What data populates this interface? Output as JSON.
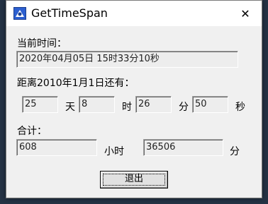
{
  "window": {
    "title": "GetTimeSpan",
    "close_glyph": "✕"
  },
  "current_time": {
    "label": "当前时间：",
    "value": "2020年04月05日 15时33分10秒"
  },
  "since": {
    "label": "距离2010年1月1日还有：",
    "days_value": "25",
    "days_unit": "天",
    "hours_value": "8",
    "hours_unit": "时",
    "minutes_value": "26",
    "minutes_unit": "分",
    "seconds_value": "50",
    "seconds_unit": "秒"
  },
  "total": {
    "label": "合计：",
    "hours_value": "608",
    "hours_unit": "小时",
    "minutes_value": "36506",
    "minutes_unit": "分"
  },
  "exit_button": {
    "label": "退出"
  },
  "icons": {
    "app": "app-icon",
    "close": "close-icon"
  },
  "colors": {
    "window_bg": "#f0f0f0",
    "titlebar_bg": "#ffffff",
    "field_bg": "#ededed"
  }
}
